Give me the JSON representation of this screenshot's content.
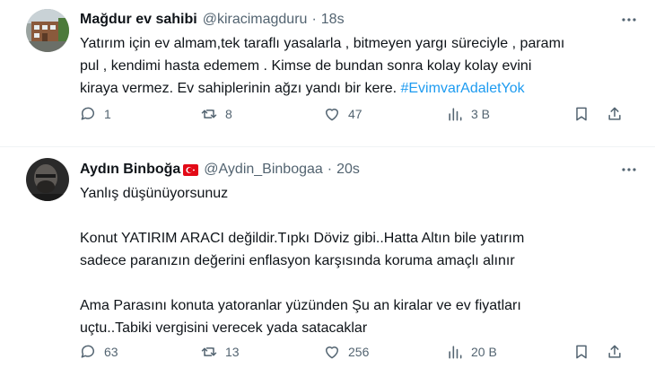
{
  "tweets": [
    {
      "name": "Mağdur ev sahibi",
      "handle": "@kiracimagduru",
      "dot": "·",
      "time": "18s",
      "text": "Yatırım için ev almam,tek taraflı yasalarla , bitmeyen yargı süreciyle , paramı\npul , kendimi hasta edemem . Kimse de bundan sonra kolay kolay evini\nkiraya vermez. Ev sahiplerinin ağzı yandı bir kere. ",
      "hashtag": "#EvimvarAdaletYok",
      "replies": "1",
      "reposts": "8",
      "likes": "47",
      "views": "3 B"
    },
    {
      "name": "Aydın Binboğa",
      "flag": "turkey-flag-icon",
      "handle": "@Aydin_Binbogaa",
      "dot": "·",
      "time": "20s",
      "text": "Yanlış düşünüyorsunuz\n\nKonut YATIRIM ARACI değildir.Tıpkı Döviz gibi..Hatta Altın bile yatırım\nsadece paranızın değerini enflasyon karşısında koruma amaçlı alınır\n\nAma Parasını konuta yatoranlar yüzünden Şu an kiralar ve ev fiyatları\nuçtu..Tabiki vergisini verecek yada satacaklar",
      "replies": "63",
      "reposts": "13",
      "likes": "256",
      "views": "20 B"
    }
  ],
  "colors": {
    "text": "#0f1419",
    "secondary": "#536471",
    "link": "#1d9bf0",
    "flag_red": "#e30a17"
  }
}
